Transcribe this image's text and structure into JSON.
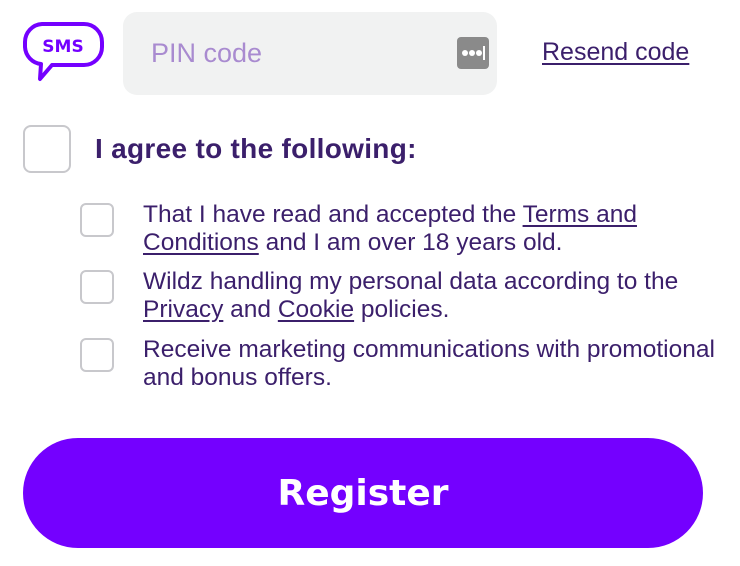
{
  "sms_badge": {
    "text": "SMS",
    "icon": "sms-chat-bubble-icon",
    "color": "#7400ff"
  },
  "pin": {
    "placeholder": "PIN code",
    "value": "",
    "password_manager_icon": "password-manager-icon"
  },
  "resend": {
    "label": "Resend code"
  },
  "agree": {
    "label": "I agree to the following:",
    "checked": false
  },
  "consents": [
    {
      "checked": false,
      "text1": "That I have read and accepted the ",
      "link1": "Terms and Conditions",
      "text2": " and I am over 18 years old."
    },
    {
      "checked": false,
      "text1": "Wildz handling my personal data according to the ",
      "link1": "Privacy",
      "text2": " and ",
      "link2": "Cookie",
      "text3": " policies."
    },
    {
      "checked": false,
      "text1": "Receive marketing communications with promotional and bonus offers."
    }
  ],
  "register": {
    "label": "Register"
  },
  "colors": {
    "brand": "#7400ff",
    "text": "#3b1f6b",
    "placeholder": "#a98bd0",
    "field_bg": "#f1f2f2"
  }
}
